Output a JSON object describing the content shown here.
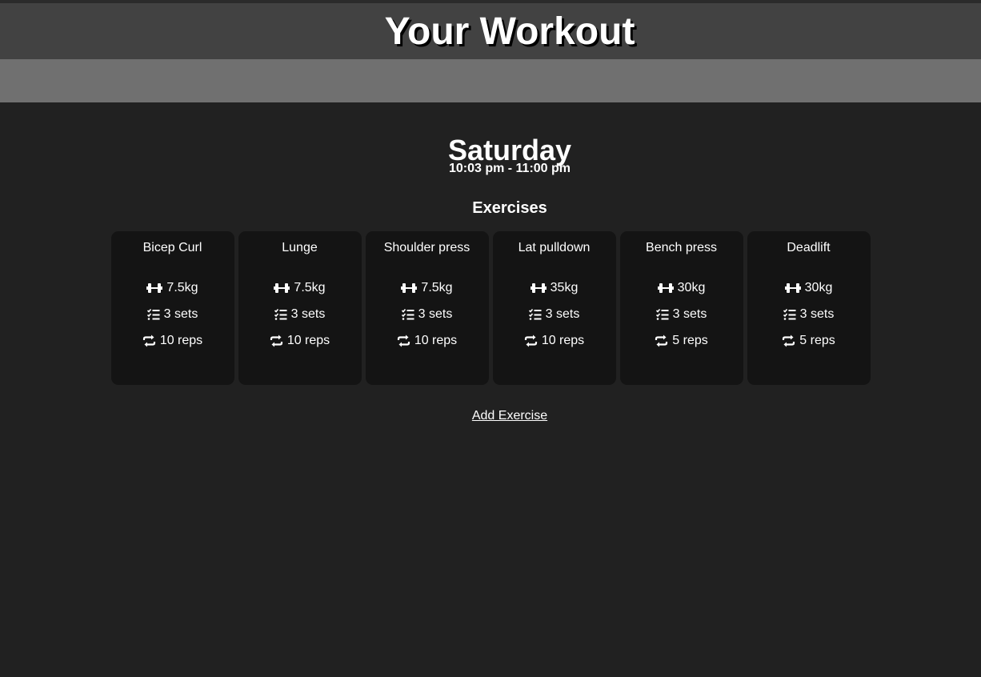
{
  "header": {
    "title": "Your Workout"
  },
  "workout": {
    "day": "Saturday",
    "time": "10:03 pm - 11:00 pm",
    "exercises_heading": "Exercises",
    "exercises": [
      {
        "name": "Bicep Curl",
        "weight": "7.5kg",
        "sets": "3 sets",
        "reps": "10 reps"
      },
      {
        "name": "Lunge",
        "weight": "7.5kg",
        "sets": "3 sets",
        "reps": "10 reps"
      },
      {
        "name": "Shoulder press",
        "weight": "7.5kg",
        "sets": "3 sets",
        "reps": "10 reps"
      },
      {
        "name": "Lat pulldown",
        "weight": "35kg",
        "sets": "3 sets",
        "reps": "10 reps"
      },
      {
        "name": "Bench press",
        "weight": "30kg",
        "sets": "3 sets",
        "reps": "5 reps"
      },
      {
        "name": "Deadlift",
        "weight": "30kg",
        "sets": "3 sets",
        "reps": "5 reps"
      }
    ],
    "add_label": "Add Exercise"
  },
  "icons": {
    "weight": "dumbbell-icon",
    "sets": "list-check-icon",
    "reps": "repeat-icon"
  },
  "colors": {
    "background": "#212121",
    "header": "#424242",
    "subbar": "#707070",
    "card": "#141414"
  }
}
